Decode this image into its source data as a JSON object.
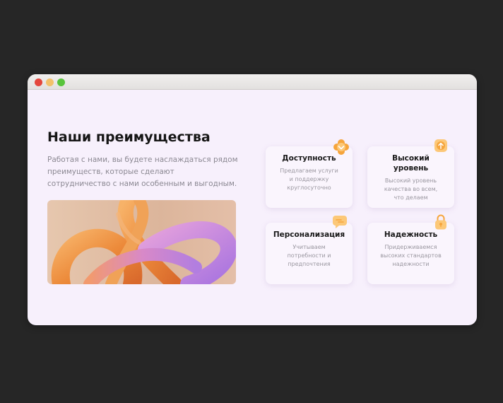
{
  "window": {
    "controls": [
      "close",
      "minimize",
      "maximize"
    ]
  },
  "section": {
    "title": "Наши преимущества",
    "description": "Работая с нами, вы будете наслаждаться рядом преимуществ, которые сделают сотрудничество с нами особенным и выгодным."
  },
  "hero_image": {
    "subject": "abstract-3d-knot"
  },
  "cards": [
    {
      "title": "Доступность",
      "text": "Предлагаем услуги и поддержку круглосуточно",
      "icon": "flower-badge-icon"
    },
    {
      "title": "Высокий уровень",
      "text": "Высокий уровень качества во всем, что делаем",
      "icon": "arrow-up-icon"
    },
    {
      "title": "Персонализация",
      "text": "Учитываем потребности и предпочтения",
      "icon": "chat-bubble-icon"
    },
    {
      "title": "Надежность",
      "text": "Придерживаемся высоких стандартов надежности",
      "icon": "lock-icon"
    }
  ],
  "colors": {
    "background": "#262626",
    "window": "#f7f0fc",
    "card": "#faf5fd",
    "accent_orange": "#f6a53c",
    "accent_light_orange": "#fcc878"
  }
}
